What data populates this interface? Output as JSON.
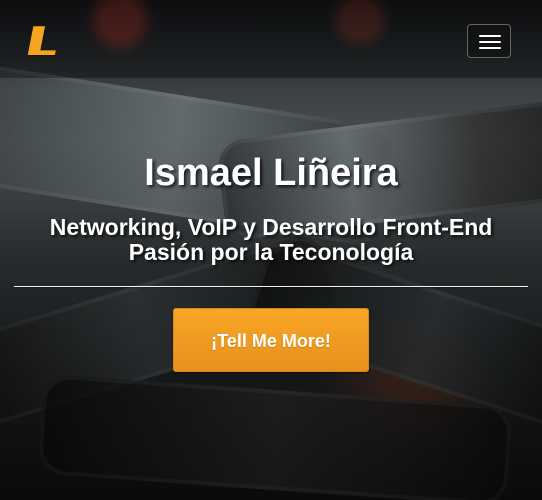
{
  "navbar": {
    "brand": "IL",
    "menu_toggle_icon": "hamburger-menu-icon"
  },
  "hero": {
    "title": "Ismael Liñeira",
    "subtitle_line_1": "Networking, VoIP y Desarrollo Front-End",
    "subtitle_line_2": "Pasión por la Teconología",
    "button_label": "¡Tell Me More!"
  },
  "colors": {
    "accent_orange": "#f5a51f",
    "text_white": "#ffffff"
  }
}
